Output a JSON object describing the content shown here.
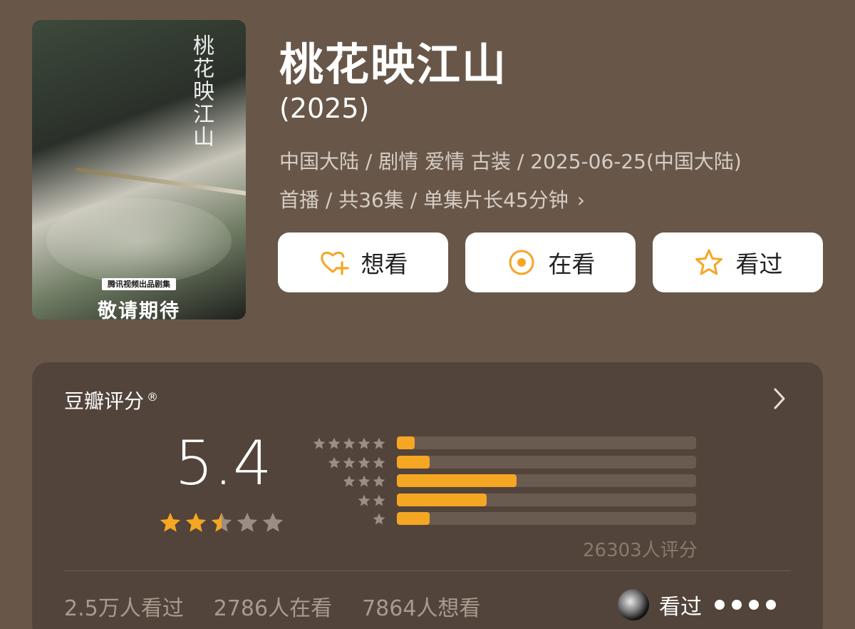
{
  "poster": {
    "calligraphy_title": "桃花映江山",
    "caption_top": "腾讯视频出品剧集",
    "caption_main": "敬请期待"
  },
  "title": "桃花映江山",
  "year": "(2025)",
  "meta": {
    "line1": "中国大陆 / 剧情 爱情 古装 / 2025-06-25(中国大陆)",
    "line2": "首播 / 共36集 / 单集片长45分钟",
    "chevron": "›"
  },
  "buttons": {
    "want": {
      "label": "想看",
      "icon": "heart-plus-icon"
    },
    "watching": {
      "label": "在看",
      "icon": "target-icon"
    },
    "watched": {
      "label": "看过",
      "icon": "star-outline-icon"
    }
  },
  "rating": {
    "title": "豆瓣评分",
    "registered_mark": "®",
    "score": "5.4",
    "stars_filled": 2.5,
    "stars_total": 5,
    "distribution": [
      {
        "stars": 5,
        "percent": 6
      },
      {
        "stars": 4,
        "percent": 11
      },
      {
        "stars": 3,
        "percent": 40
      },
      {
        "stars": 2,
        "percent": 30
      },
      {
        "stars": 1,
        "percent": 11
      }
    ],
    "votes_label": "26303人评分"
  },
  "stats": {
    "watched": "2.5万人看过",
    "watching": "2786人在看",
    "want": "7864人想看"
  },
  "footer": {
    "watched_label": "看过"
  },
  "colors": {
    "background": "#685749",
    "card": "#52443a",
    "accent": "#f5a623",
    "muted_star": "#9a8d83"
  }
}
